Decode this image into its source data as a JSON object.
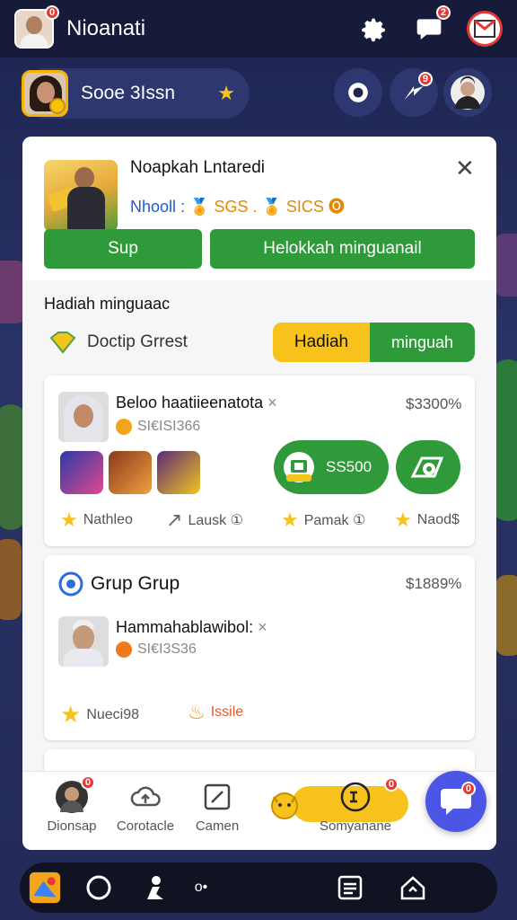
{
  "topbar": {
    "title": "Nioanati",
    "avatar_badge": "0",
    "chat_badge": "2",
    "icons": [
      "settings-icon",
      "chat-icon",
      "mail-icon"
    ]
  },
  "profile": {
    "name": "Sooe 3Issn",
    "star": "★",
    "alert_badge": "9"
  },
  "promo": {
    "title": "Noapkah Lntaredi",
    "sub_prefix": "Nhooll :",
    "sub_values": "🏅 SGS . 🏅 SICS 🅞",
    "close": "✕",
    "btn_small": "Sup",
    "btn_large": "Helokkah minguanail"
  },
  "bonus": {
    "heading": "Hadiah minguaac",
    "label": "Doctip Grrest",
    "toggle_on": "Hadiah",
    "toggle_off": "minguah"
  },
  "cards": [
    {
      "name": "Beloo haatiieenatota",
      "x": "×",
      "sub": "SI€ISI366",
      "amount": "$3300%",
      "pill_amount": "SS500",
      "meta": [
        "Nathleo",
        "Lausk ①",
        "Pamak ①",
        "Naod$"
      ]
    },
    {
      "title": "Grup Grup",
      "amount": "$1889%",
      "name": "Hammahablawibol:",
      "x": "×",
      "sub": "SI€I3S36",
      "meta": [
        "Nueci98",
        "Issile"
      ]
    }
  ],
  "nav": {
    "items": [
      "Dionsap",
      "Corotacle",
      "Camen",
      "Somyanane"
    ],
    "badge1": "0",
    "badge_yellow": "0"
  },
  "fab_badge": "0",
  "sysbar": {
    "dots": "o•"
  }
}
